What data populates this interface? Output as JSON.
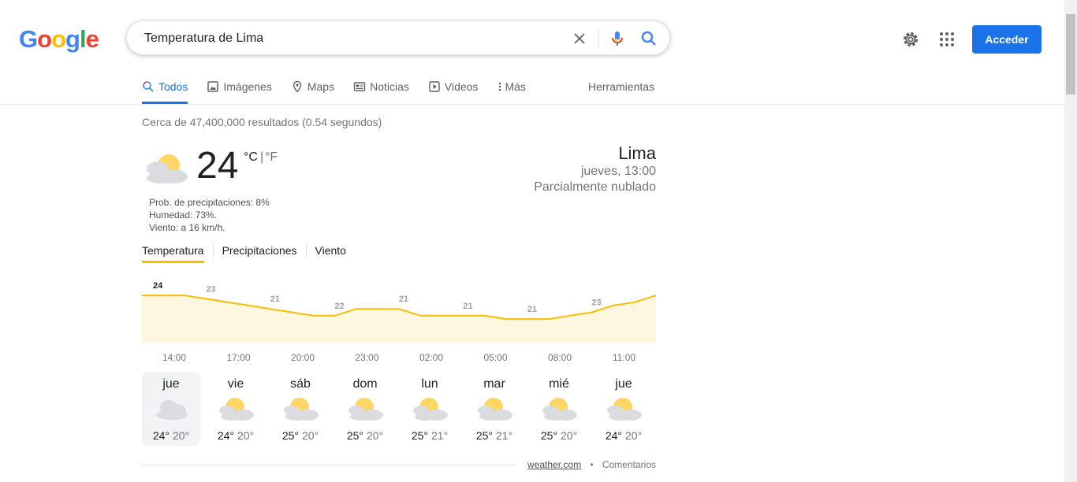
{
  "logo": {
    "letters": [
      "G",
      "o",
      "o",
      "g",
      "l",
      "e"
    ],
    "colors": [
      "#4285f4",
      "#ea4335",
      "#fbbc05",
      "#4285f4",
      "#34a853",
      "#ea4335"
    ]
  },
  "search": {
    "query": "Temperatura de Lima",
    "clear_icon": "close-icon",
    "voice_icon": "mic-icon",
    "search_icon": "search-icon"
  },
  "header": {
    "settings_icon": "gear-icon",
    "apps_icon": "apps-grid-icon",
    "signin_label": "Acceder"
  },
  "nav": {
    "tabs": [
      {
        "label": "Todos",
        "icon": "search-icon",
        "active": true
      },
      {
        "label": "Imágenes",
        "icon": "image-icon"
      },
      {
        "label": "Maps",
        "icon": "map-pin-icon"
      },
      {
        "label": "Noticias",
        "icon": "news-icon"
      },
      {
        "label": "Videos",
        "icon": "play-icon"
      },
      {
        "label": "Más",
        "icon": "more-vert-icon"
      }
    ],
    "tools_label": "Herramientas"
  },
  "results_stats": "Cerca de 47,400,000 resultados (0.54 segundos)",
  "weather": {
    "temperature": "24",
    "unit_c": "°C",
    "unit_sep": "|",
    "unit_f": "°F",
    "precip": "Prob. de precipitaciones: 8%",
    "humidity": "Humedad: 73%.",
    "wind": "Viento: a 16 km/h.",
    "location": "Lima",
    "datetime": "jueves, 13:00",
    "condition": "Parcialmente nublado",
    "tabs": [
      "Temperatura",
      "Precipitaciones",
      "Viento"
    ],
    "hourly_labels": [
      "14:00",
      "17:00",
      "20:00",
      "23:00",
      "02:00",
      "05:00",
      "08:00",
      "11:00"
    ],
    "days": [
      {
        "name": "jue",
        "hi": "24°",
        "lo": "20°",
        "icon": "cloudy",
        "selected": true
      },
      {
        "name": "vie",
        "hi": "24°",
        "lo": "20°",
        "icon": "partly-cloudy"
      },
      {
        "name": "sáb",
        "hi": "25°",
        "lo": "20°",
        "icon": "partly-cloudy"
      },
      {
        "name": "dom",
        "hi": "25°",
        "lo": "20°",
        "icon": "partly-cloudy"
      },
      {
        "name": "lun",
        "hi": "25°",
        "lo": "21°",
        "icon": "partly-cloudy"
      },
      {
        "name": "mar",
        "hi": "25°",
        "lo": "21°",
        "icon": "partly-cloudy"
      },
      {
        "name": "mié",
        "hi": "25°",
        "lo": "20°",
        "icon": "partly-cloudy"
      },
      {
        "name": "jue",
        "hi": "24°",
        "lo": "20°",
        "icon": "partly-cloudy"
      }
    ],
    "source": "weather.com",
    "bullet": "•",
    "feedback": "Comentarios"
  },
  "chart_data": {
    "type": "area",
    "x": [
      "13:00",
      "14:00",
      "15:00",
      "16:00",
      "17:00",
      "18:00",
      "19:00",
      "20:00",
      "21:00",
      "22:00",
      "23:00",
      "00:00",
      "01:00",
      "02:00",
      "03:00",
      "04:00",
      "05:00",
      "06:00",
      "07:00",
      "08:00",
      "09:00",
      "10:00",
      "11:00",
      "12:00",
      "13:00"
    ],
    "values": [
      24,
      24,
      24,
      23.5,
      23,
      22.5,
      22,
      21.5,
      21,
      21,
      22,
      22,
      22,
      21,
      21,
      21,
      21,
      20.5,
      20.5,
      20.5,
      21,
      21.5,
      22.5,
      23,
      24
    ],
    "labels": [
      {
        "text": "24",
        "x": "13:00"
      },
      {
        "text": "23",
        "x": "16:00"
      },
      {
        "text": "21",
        "x": "19:00"
      },
      {
        "text": "22",
        "x": "22:00"
      },
      {
        "text": "21",
        "x": "01:00"
      },
      {
        "text": "21",
        "x": "04:00"
      },
      {
        "text": "21",
        "x": "07:00"
      },
      {
        "text": "23",
        "x": "10:00"
      }
    ],
    "line_color": "#fbbc04",
    "fill_color": "#fef7e0",
    "ylim": [
      17,
      26
    ]
  }
}
